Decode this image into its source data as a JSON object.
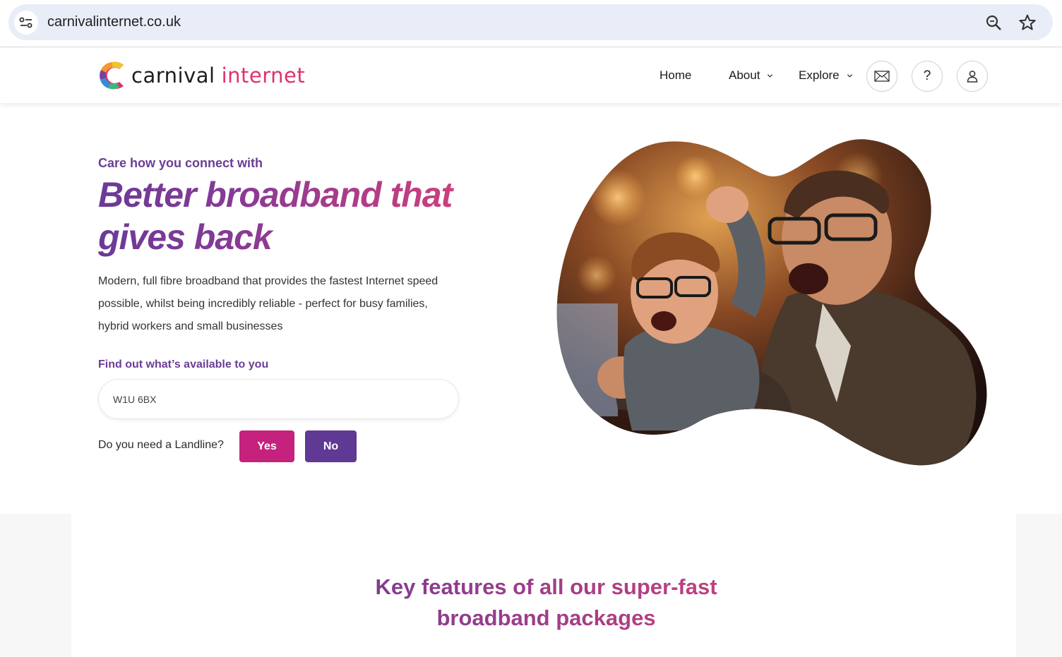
{
  "browser": {
    "url": "carnivalinternet.co.uk",
    "icons": [
      "site-info-icon",
      "zoom-icon",
      "bookmark-star-icon"
    ]
  },
  "header": {
    "logo": {
      "word1": "carnival",
      "word2": "internet"
    },
    "nav": {
      "home": "Home",
      "about": "About",
      "explore": "Explore"
    },
    "icons": [
      "mail-icon",
      "help-icon",
      "user-icon"
    ],
    "help_glyph": "?"
  },
  "hero": {
    "eyebrow": "Care how you connect with",
    "title": "Better broadband that gives back",
    "description": "Modern, full fibre broadband that provides the fastest Internet speed possible, whilst being incredibly reliable - perfect for busy families, hybrid workers and small businesses",
    "availability_label": "Find out what’s available to you",
    "postcode_value": "W1U 6BX",
    "landline_question": "Do you need a Landline?",
    "yes_label": "Yes",
    "no_label": "No",
    "image_alt": "Father and son celebrating in front of a screen"
  },
  "features": {
    "title": "Key features of all our super-fast broadband packages"
  },
  "colors": {
    "brand_purple": "#6b3d94",
    "brand_pink": "#e0306f",
    "yes_button": "#c4227d",
    "no_button": "#5f3994"
  }
}
